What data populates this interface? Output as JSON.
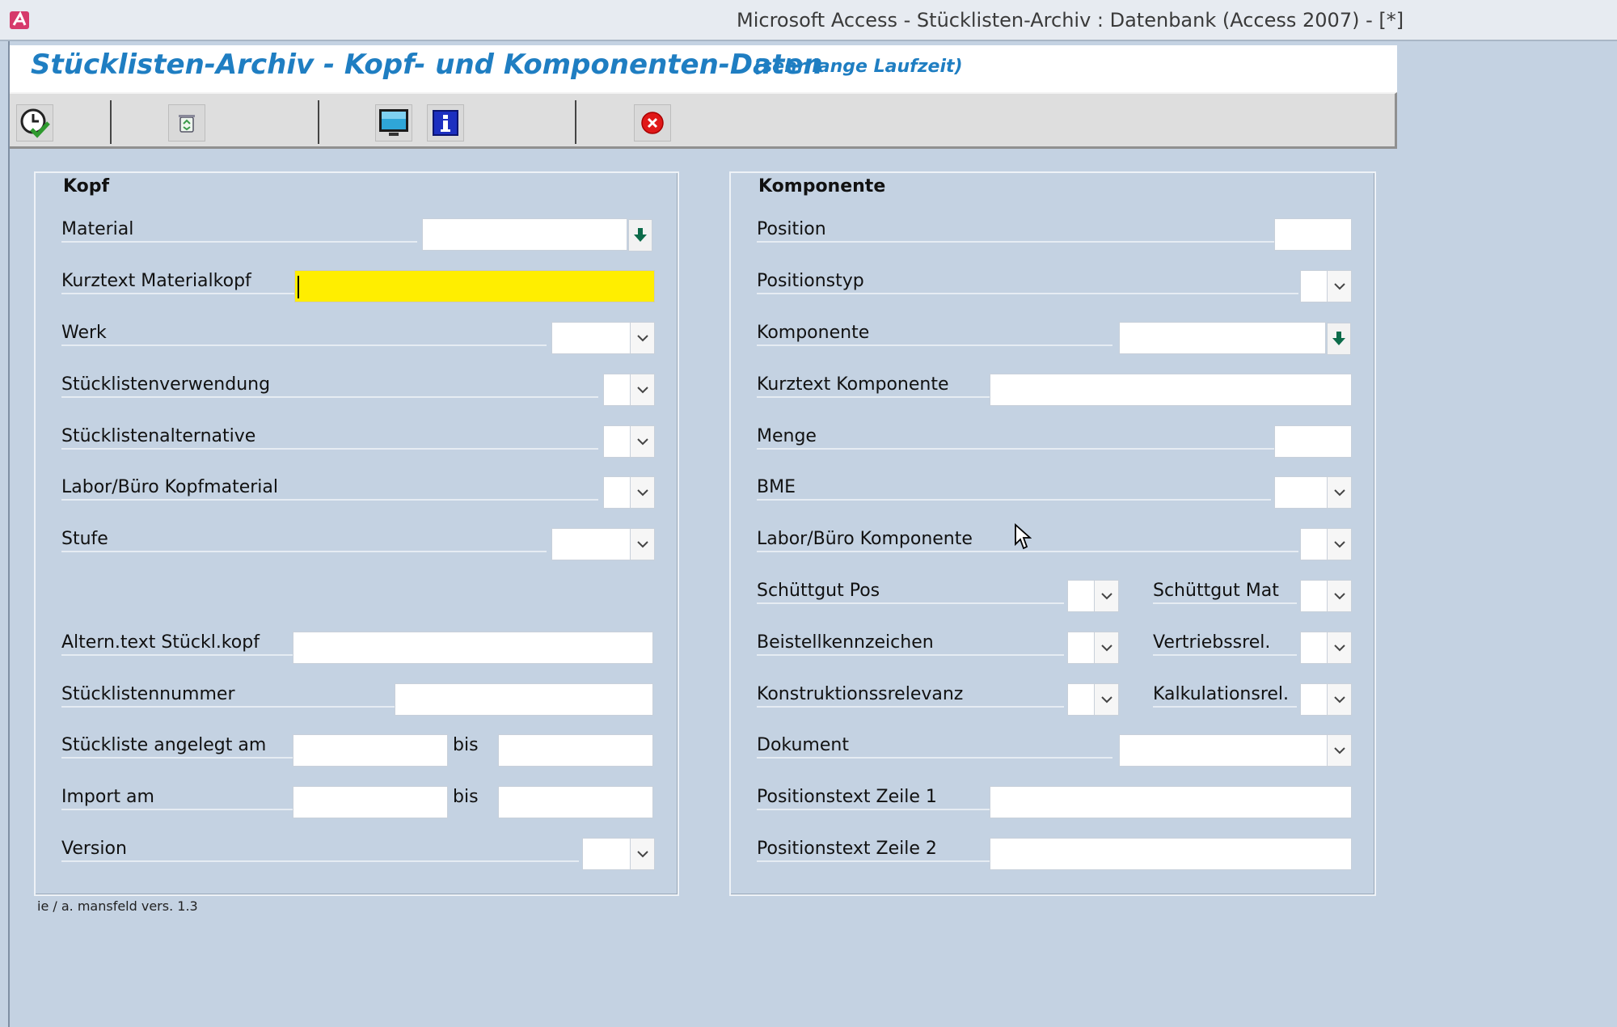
{
  "window": {
    "title": "Microsoft Access - Stücklisten-Archiv : Datenbank (Access 2007) - [*]"
  },
  "header": {
    "title": "Stücklisten-Archiv - Kopf- und Komponenten-Daten",
    "subtitle": "(sehr lange Laufzeit)"
  },
  "toolbar": {
    "buttons": [
      {
        "name": "run-query-button",
        "icon": "clock-check-icon"
      },
      {
        "name": "clear-button",
        "icon": "recycle-bin-icon"
      },
      {
        "name": "screen-button",
        "icon": "monitor-icon"
      },
      {
        "name": "info-button",
        "icon": "info-icon"
      },
      {
        "name": "close-button",
        "icon": "close-icon"
      }
    ]
  },
  "kopf": {
    "title": "Kopf",
    "material": {
      "label": "Material",
      "value": ""
    },
    "kurztext": {
      "label": "Kurztext Materialkopf",
      "value": ""
    },
    "werk": {
      "label": "Werk",
      "value": ""
    },
    "verwendung": {
      "label": "Stücklistenverwendung",
      "value": ""
    },
    "alternative": {
      "label": "Stücklistenalternative",
      "value": ""
    },
    "labor": {
      "label": "Labor/Büro Kopfmaterial",
      "value": ""
    },
    "stufe": {
      "label": "Stufe",
      "value": ""
    },
    "alterntext": {
      "label": "Altern.text Stückl.kopf",
      "value": ""
    },
    "nummer": {
      "label": "Stücklistennummer",
      "value": ""
    },
    "angelegt": {
      "label": "Stückliste angelegt am",
      "bis": "bis",
      "from": "",
      "to": ""
    },
    "import": {
      "label": "Import am",
      "bis": "bis",
      "from": "",
      "to": ""
    },
    "version": {
      "label": "Version",
      "value": ""
    }
  },
  "komponente": {
    "title": "Komponente",
    "position": {
      "label": "Position",
      "value": ""
    },
    "positionstyp": {
      "label": "Positionstyp",
      "value": ""
    },
    "komponente": {
      "label": "Komponente",
      "value": ""
    },
    "kurztext": {
      "label": "Kurztext Komponente",
      "value": ""
    },
    "menge": {
      "label": "Menge",
      "value": ""
    },
    "bme": {
      "label": "BME",
      "value": ""
    },
    "labor": {
      "label": "Labor/Büro Komponente",
      "value": ""
    },
    "schuettgut_pos": {
      "label": "Schüttgut Pos",
      "value": ""
    },
    "schuettgut_mat": {
      "label": "Schüttgut Mat",
      "value": ""
    },
    "beistell": {
      "label": "Beistellkennzeichen",
      "value": ""
    },
    "vertrieb": {
      "label": "Vertriebssrel.",
      "value": ""
    },
    "konstruktion": {
      "label": "Konstruktionssrelevanz",
      "value": ""
    },
    "kalkulation": {
      "label": "Kalkulationsrel.",
      "value": ""
    },
    "dokument": {
      "label": "Dokument",
      "value": ""
    },
    "postext1": {
      "label": "Positionstext Zeile 1",
      "value": ""
    },
    "postext2": {
      "label": "Positionstext Zeile 2",
      "value": ""
    }
  },
  "footer": {
    "note": "ie / a. mansfeld vers. 1.3"
  }
}
